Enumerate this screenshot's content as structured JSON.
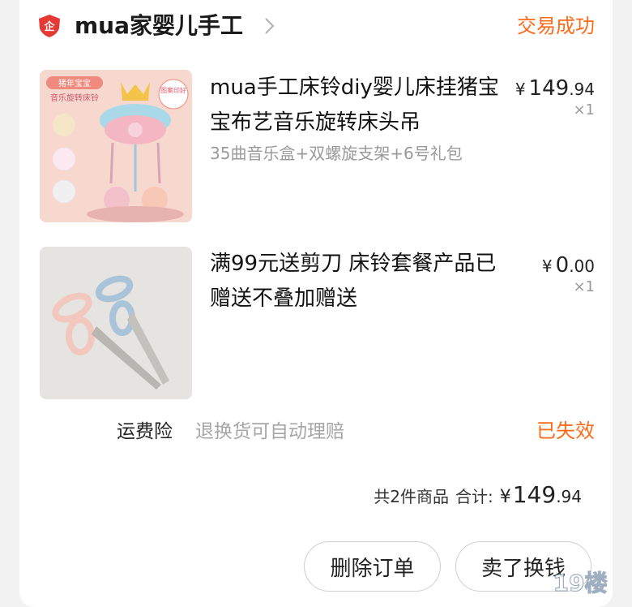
{
  "header": {
    "shop_name": "mua家婴儿手工",
    "order_status": "交易成功",
    "shop_icon": "shop-badge-icon",
    "chevron_icon": "chevron-right-icon"
  },
  "items": [
    {
      "title": "mua手工床铃diy婴儿床挂猪宝宝布艺音乐旋转床头吊",
      "sku": "35曲音乐盒+双螺旋支架+6号礼包",
      "price_currency": "¥",
      "price_int": "149",
      "price_dec": ".94",
      "quantity": "×1",
      "image_texts": {
        "badge": "猪年宝宝",
        "subtitle": "音乐旋转床铃",
        "stamp": "图案印好"
      }
    },
    {
      "title": "满99元送剪刀 床铃套餐产品已赠送不叠加赠送",
      "price_currency": "¥",
      "price_int": "0",
      "price_dec": ".00",
      "quantity": "×1"
    }
  ],
  "insurance": {
    "label": "运费险",
    "description": "退换货可自动理赔",
    "status": "已失效"
  },
  "summary": {
    "count_text": "共2件商品",
    "total_label": "合计:",
    "currency": "¥",
    "total_int": "149",
    "total_dec": ".94"
  },
  "actions": {
    "delete_label": "删除订单",
    "sell_label": "卖了换钱"
  },
  "watermark": {
    "text": "19楼"
  },
  "colors": {
    "accent": "#ff6a1a",
    "muted": "#9a9a9a",
    "shop_icon_red": "#e53935"
  }
}
